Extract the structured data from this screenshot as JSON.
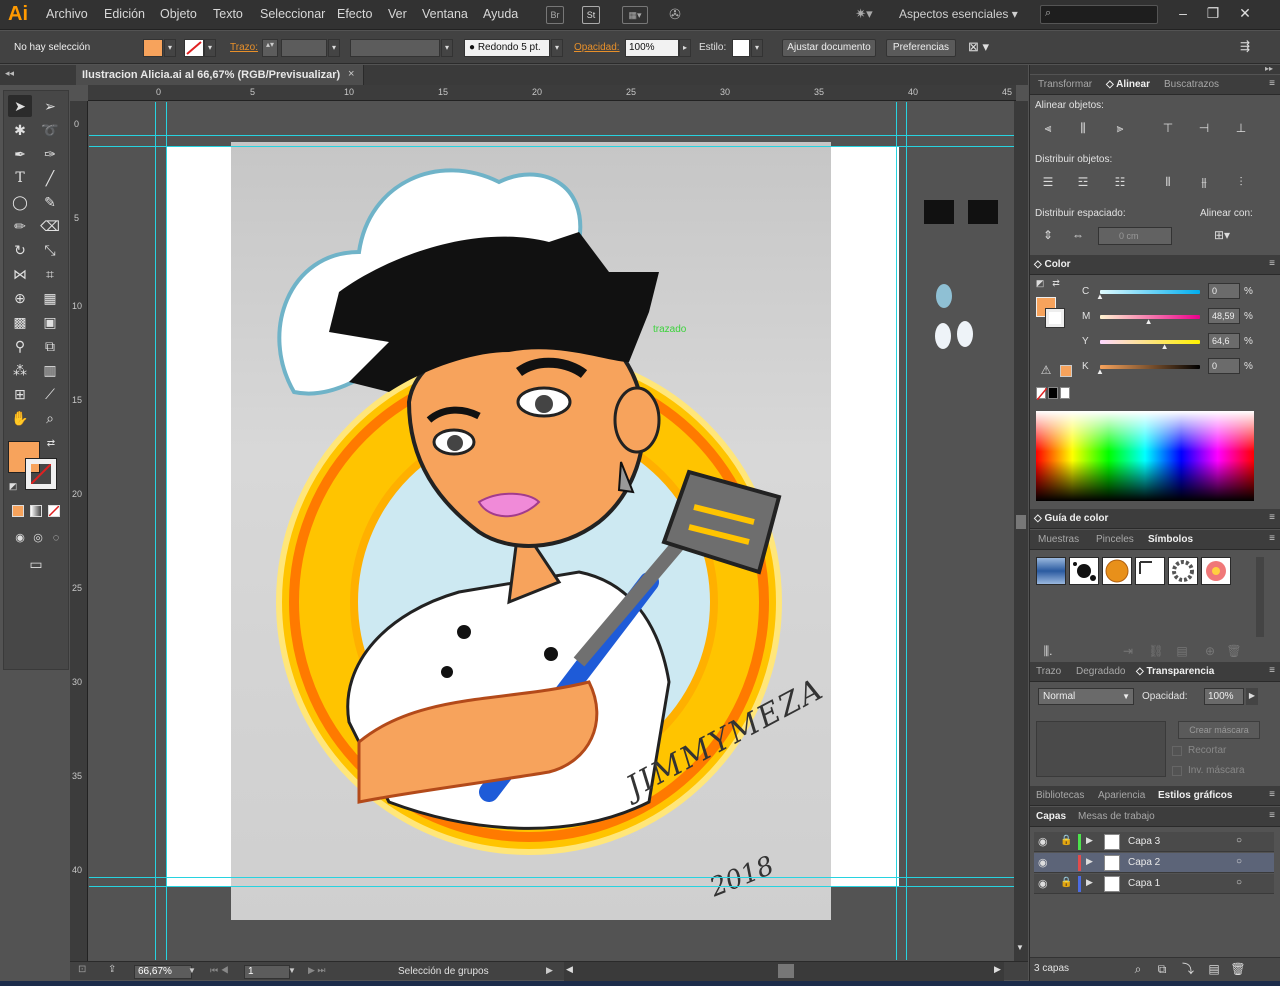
{
  "app": {
    "logo": "Ai"
  },
  "menu": [
    "Archivo",
    "Edición",
    "Objeto",
    "Texto",
    "Seleccionar",
    "Efecto",
    "Ver",
    "Ventana",
    "Ayuda"
  ],
  "menubar_icons": [
    "Br",
    "St"
  ],
  "workspace": "Aspectos esenciales",
  "control": {
    "selection": "No hay selección",
    "stroke_label": "Trazo:",
    "brush": "Redondo 5 pt.",
    "opacity_label": "Opacidad:",
    "opacity": "100%",
    "style_label": "Estilo:",
    "adjust_doc": "Ajustar documento",
    "prefs": "Preferencias",
    "fill_color": "#f7a35c"
  },
  "document": {
    "tab_title": "Ilustracion Alicia.ai al 66,67% (RGB/Previsualizar)",
    "close": "×"
  },
  "ruler_top": [
    "0",
    "5",
    "10",
    "15",
    "20",
    "25",
    "30",
    "35",
    "40",
    "45"
  ],
  "ruler_left": [
    "0",
    "5",
    "10",
    "15",
    "20",
    "25",
    "30",
    "35",
    "40"
  ],
  "canvas": {
    "trazado": "trazado",
    "signature": "JIMMYMEZA",
    "signature_year": "2018"
  },
  "status": {
    "zoom": "66,67%",
    "page": "1",
    "text": "Selección de grupos"
  },
  "align_panel": {
    "tabs": [
      "Transformar",
      "Alinear",
      "Buscatrazos"
    ],
    "active_tab": "Alinear",
    "align_objects": "Alinear objetos:",
    "distribute_objects": "Distribuir objetos:",
    "distribute_spacing": "Distribuir espaciado:",
    "align_to": "Alinear con:",
    "spacing_value": "0 cm"
  },
  "color_panel": {
    "title": "Color",
    "channels": [
      {
        "name": "C",
        "value": "0",
        "unit": "%",
        "level": 0.0,
        "gradient": [
          "#e0fbff",
          "#00aeef"
        ]
      },
      {
        "name": "M",
        "value": "48,59",
        "unit": "%",
        "level": 0.4859,
        "gradient": [
          "#fff4d0",
          "#ec008c"
        ]
      },
      {
        "name": "Y",
        "value": "64,6",
        "unit": "%",
        "level": 0.646,
        "gradient": [
          "#fdd7ff",
          "#fff200"
        ]
      },
      {
        "name": "K",
        "value": "0",
        "unit": "%",
        "level": 0.0,
        "gradient": [
          "#f7a35c",
          "#000000"
        ]
      }
    ]
  },
  "guide_panel": {
    "title": "Guía de color"
  },
  "symbols_panel": {
    "tabs": [
      "Muestras",
      "Pinceles",
      "Símbolos"
    ],
    "active_tab": "Símbolos"
  },
  "transparency_panel": {
    "tabs": [
      "Trazo",
      "Degradado",
      "Transparencia"
    ],
    "active_tab": "Transparencia",
    "blend_mode": "Normal",
    "opacity_label": "Opacidad:",
    "opacity": "100%",
    "make_mask": "Crear máscara",
    "clip": "Recortar",
    "invert_mask": "Inv. máscara"
  },
  "libraries_panel": {
    "tabs": [
      "Bibliotecas",
      "Apariencia",
      "Estilos gráficos"
    ],
    "active_tab": "Estilos gráficos"
  },
  "layers_panel": {
    "tabs": [
      "Capas",
      "Mesas de trabajo"
    ],
    "active_tab": "Capas",
    "layers": [
      {
        "name": "Capa 3",
        "color": "#4ce24c",
        "locked": true,
        "selected": false
      },
      {
        "name": "Capa 2",
        "color": "#e24c4c",
        "locked": false,
        "selected": true
      },
      {
        "name": "Capa 1",
        "color": "#4c6ce2",
        "locked": true,
        "selected": false
      }
    ],
    "count": "3 capas"
  }
}
